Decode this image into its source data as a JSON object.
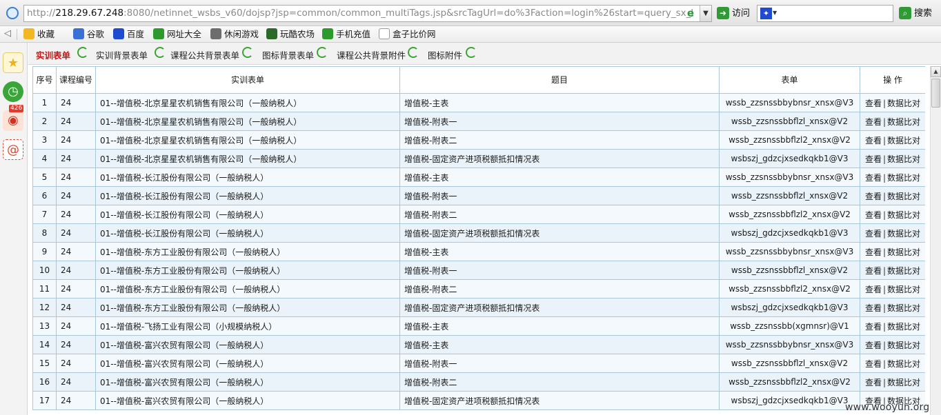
{
  "browser": {
    "url_prefix": "http://",
    "url_host": "218.29.67.248",
    "url_rest": ":8080/netinnet_wsbs_v60/dojsp?jsp=common/common_multiTags.jsp&srcTagUrl=do%3Faction=login%26start=query_sx_l",
    "go_label": "访问",
    "search_label": "搜索",
    "search_value": ""
  },
  "favorites": [
    {
      "label": "收藏",
      "icon": "star-icon",
      "color": "#f2b824"
    },
    {
      "label": "谷歌",
      "icon": "google-icon",
      "color": "#3b6fd6"
    },
    {
      "label": "百度",
      "icon": "baidu-icon",
      "color": "#1f4bd1"
    },
    {
      "label": "网址大全",
      "icon": "nav-icon",
      "color": "#2e9a2e"
    },
    {
      "label": "休闲游戏",
      "icon": "game-icon",
      "color": "#6d6d6d"
    },
    {
      "label": "玩酷农场",
      "icon": "farm-icon",
      "color": "#2a6b2a"
    },
    {
      "label": "手机充值",
      "icon": "phone-icon",
      "color": "#2e9a2e"
    },
    {
      "label": "盒子比价网",
      "icon": "page-icon",
      "color": "#ffffff"
    }
  ],
  "sidebar": {
    "badge": "426"
  },
  "tabs": [
    {
      "label": "实训表单",
      "active": true
    },
    {
      "label": "实训背景表单",
      "active": false
    },
    {
      "label": "课程公共背景表单",
      "active": false
    },
    {
      "label": "图标背景表单",
      "active": false
    },
    {
      "label": "课程公共背景附件",
      "active": false
    },
    {
      "label": "图标附件",
      "active": false
    }
  ],
  "table": {
    "headers": {
      "idx": "序号",
      "course": "课程编号",
      "form": "实训表单",
      "topic": "题目",
      "sheet": "表单",
      "ops": "操 作"
    },
    "op_view": "查看",
    "op_sep": "|",
    "op_compare": "数据比对",
    "rows": [
      {
        "idx": "1",
        "course": "24",
        "form": "01--增值税-北京星星农机销售有限公司（一般纳税人）",
        "topic": "增值税-主表",
        "sheet": "wssb_zzsnssbbybnsr_xnsx@V3"
      },
      {
        "idx": "2",
        "course": "24",
        "form": "01--增值税-北京星星农机销售有限公司（一般纳税人）",
        "topic": "增值税-附表一",
        "sheet": "wssb_zzsnssbbflzl_xnsx@V2"
      },
      {
        "idx": "3",
        "course": "24",
        "form": "01--增值税-北京星星农机销售有限公司（一般纳税人）",
        "topic": "增值税-附表二",
        "sheet": "wssb_zzsnssbbflzl2_xnsx@V2"
      },
      {
        "idx": "4",
        "course": "24",
        "form": "01--增值税-北京星星农机销售有限公司（一般纳税人）",
        "topic": "增值税-固定资产进项税额抵扣情况表",
        "sheet": "wsbszj_gdzcjxsedkqkb1@V3"
      },
      {
        "idx": "5",
        "course": "24",
        "form": "01--增值税-长江股份有限公司（一般纳税人）",
        "topic": "增值税-主表",
        "sheet": "wssb_zzsnssbbybnsr_xnsx@V3"
      },
      {
        "idx": "6",
        "course": "24",
        "form": "01--增值税-长江股份有限公司（一般纳税人）",
        "topic": "增值税-附表一",
        "sheet": "wssb_zzsnssbbflzl_xnsx@V2"
      },
      {
        "idx": "7",
        "course": "24",
        "form": "01--增值税-长江股份有限公司（一般纳税人）",
        "topic": "增值税-附表二",
        "sheet": "wssb_zzsnssbbflzl2_xnsx@V2"
      },
      {
        "idx": "8",
        "course": "24",
        "form": "01--增值税-长江股份有限公司（一般纳税人）",
        "topic": "增值税-固定资产进项税额抵扣情况表",
        "sheet": "wsbszj_gdzcjxsedkqkb1@V3"
      },
      {
        "idx": "9",
        "course": "24",
        "form": "01--增值税-东方工业股份有限公司（一般纳税人）",
        "topic": "增值税-主表",
        "sheet": "wssb_zzsnssbbybnsr_xnsx@V3"
      },
      {
        "idx": "10",
        "course": "24",
        "form": "01--增值税-东方工业股份有限公司（一般纳税人）",
        "topic": "增值税-附表一",
        "sheet": "wssb_zzsnssbbflzl_xnsx@V2"
      },
      {
        "idx": "11",
        "course": "24",
        "form": "01--增值税-东方工业股份有限公司（一般纳税人）",
        "topic": "增值税-附表二",
        "sheet": "wssb_zzsnssbbflzl2_xnsx@V2"
      },
      {
        "idx": "12",
        "course": "24",
        "form": "01--增值税-东方工业股份有限公司（一般纳税人）",
        "topic": "增值税-固定资产进项税额抵扣情况表",
        "sheet": "wsbszj_gdzcjxsedkqkb1@V3"
      },
      {
        "idx": "13",
        "course": "24",
        "form": "01--增值税-飞扬工业有限公司（小规模纳税人）",
        "topic": "增值税-主表",
        "sheet": "wssb_zzsnssbb(xgmnsr)@V1"
      },
      {
        "idx": "14",
        "course": "24",
        "form": "01--增值税-富兴农贸有限公司（一般纳税人）",
        "topic": "增值税-主表",
        "sheet": "wssb_zzsnssbbybnsr_xnsx@V3"
      },
      {
        "idx": "15",
        "course": "24",
        "form": "01--增值税-富兴农贸有限公司（一般纳税人）",
        "topic": "增值税-附表一",
        "sheet": "wssb_zzsnssbbflzl_xnsx@V2"
      },
      {
        "idx": "16",
        "course": "24",
        "form": "01--增值税-富兴农贸有限公司（一般纳税人）",
        "topic": "增值税-附表二",
        "sheet": "wssb_zzsnssbbflzl2_xnsx@V2"
      },
      {
        "idx": "17",
        "course": "24",
        "form": "01--增值税-富兴农贸有限公司（一般纳税人）",
        "topic": "增值税-固定资产进项税额抵扣情况表",
        "sheet": "wsbszj_gdzcjxsedkqkb1@V3"
      }
    ]
  },
  "watermark": "www.wooyun.org"
}
